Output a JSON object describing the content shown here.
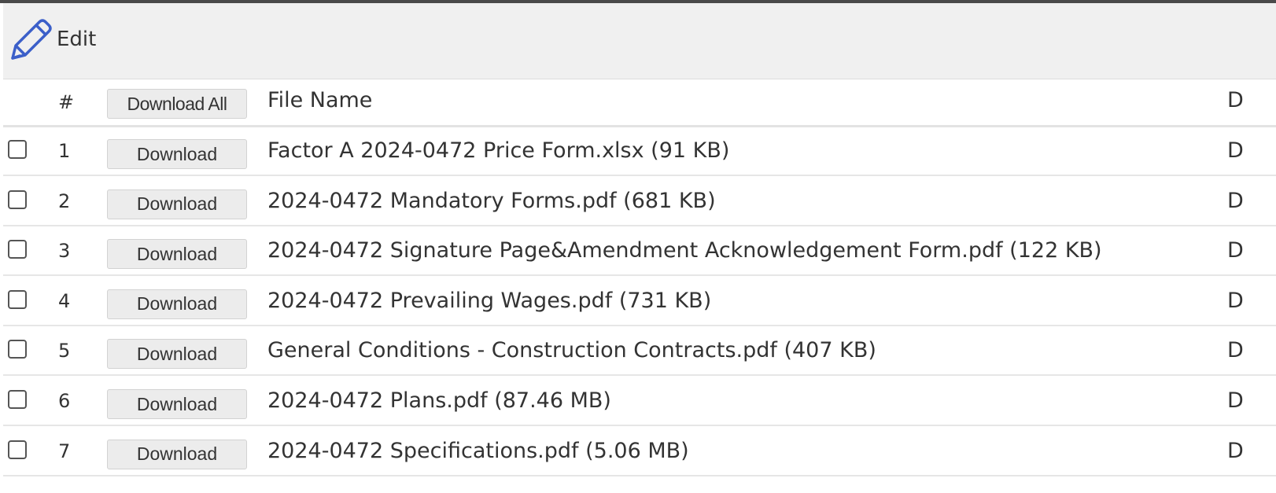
{
  "toolbar": {
    "edit_label": "Edit",
    "edit_icon": "pencil-icon",
    "accent_color": "#3b5fc9"
  },
  "table": {
    "headers": {
      "number": "#",
      "download_all": "Download All",
      "file_name": "File Name",
      "next_col_partial": "D"
    },
    "download_label": "Download",
    "rows": [
      {
        "number": "1",
        "file": "Factor A 2024-0472 Price Form.xlsx (91 KB)",
        "next_col_partial": "D"
      },
      {
        "number": "2",
        "file": "2024-0472 Mandatory Forms.pdf (681 KB)",
        "next_col_partial": "D"
      },
      {
        "number": "3",
        "file": "2024-0472 Signature Page&Amendment Acknowledgement Form.pdf (122 KB)",
        "next_col_partial": "D"
      },
      {
        "number": "4",
        "file": "2024-0472 Prevailing Wages.pdf (731 KB)",
        "next_col_partial": "D"
      },
      {
        "number": "5",
        "file": "General Conditions - Construction Contracts.pdf (407 KB)",
        "next_col_partial": "D"
      },
      {
        "number": "6",
        "file": "2024-0472 Plans.pdf (87.46 MB)",
        "next_col_partial": "D"
      },
      {
        "number": "7",
        "file": "2024-0472 Specifications.pdf (5.06 MB)",
        "next_col_partial": "D"
      }
    ]
  }
}
